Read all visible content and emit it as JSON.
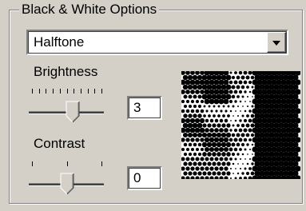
{
  "group": {
    "title": "Black & White Options"
  },
  "mode_select": {
    "value": "Halftone"
  },
  "brightness": {
    "label": "Brightness",
    "value": "3",
    "level_percent": 58,
    "tick_count": 11
  },
  "contrast": {
    "label": "Contrast",
    "value": "0",
    "level_percent": 50,
    "tick_count": 3
  },
  "preview": {
    "image": "halftone-preview",
    "colors": {
      "dark": "#000000",
      "light": "#ffffff"
    }
  }
}
